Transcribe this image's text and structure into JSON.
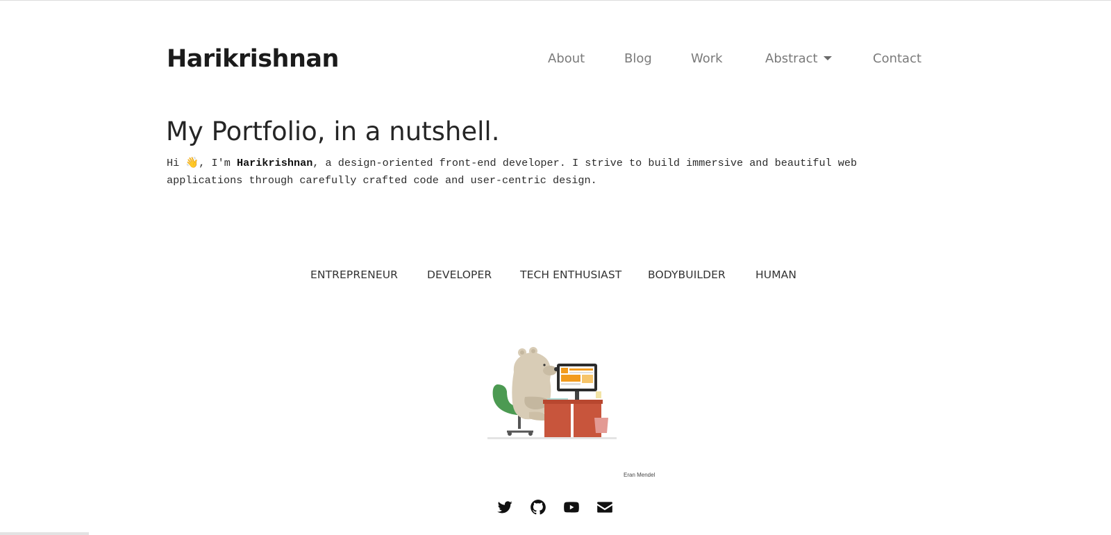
{
  "brand": {
    "name": "Harikrishnan"
  },
  "nav": {
    "items": [
      {
        "label": "About"
      },
      {
        "label": "Blog"
      },
      {
        "label": "Work"
      },
      {
        "label": "Abstract"
      },
      {
        "label": "Contact"
      }
    ]
  },
  "hero": {
    "title": "My Portfolio, in a nutshell.",
    "intro_prefix": "Hi ",
    "wave_emoji": "👋",
    "intro_im": ", I'm ",
    "intro_name": "Harikrishnan",
    "intro_rest": ", a design-oriented front-end developer. I strive to build immersive and beautiful web applications through carefully crafted code and user-centric design."
  },
  "roles": [
    "ENTREPRENEUR",
    "DEVELOPER",
    "TECH ENTHUSIAST",
    "BODYBUILDER",
    "HUMAN"
  ],
  "illustration": {
    "credit": "Eran Mendel"
  },
  "social": [
    {
      "icon": "twitter-icon"
    },
    {
      "icon": "github-icon"
    },
    {
      "icon": "youtube-icon"
    },
    {
      "icon": "envelope-icon"
    }
  ],
  "colors": {
    "text_dark": "#1b1b1b",
    "nav_text": "#7a7a7a",
    "bear": "#d8ccb6",
    "chair": "#4c9a52",
    "desk": "#c8553c",
    "screen_accent": "#f29b1e"
  }
}
